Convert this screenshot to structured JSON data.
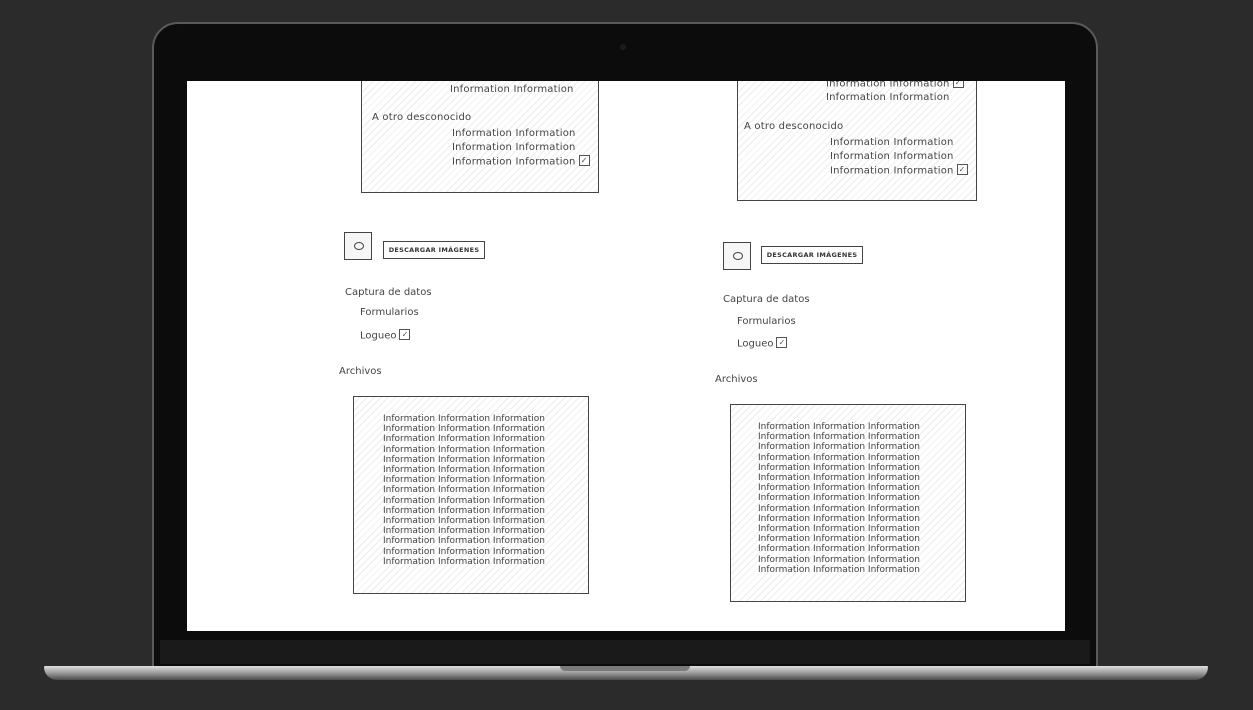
{
  "mockup": {
    "info_pair": "Information Information",
    "info_triple": "Information Information Information",
    "section_other": "A otro desconocido",
    "download_button": "DESCARGAR IMÁGENES",
    "data_capture": "Captura de datos",
    "forms": "Formularios",
    "login": "Logueo",
    "files": "Archivos",
    "checkmark": "✓"
  }
}
